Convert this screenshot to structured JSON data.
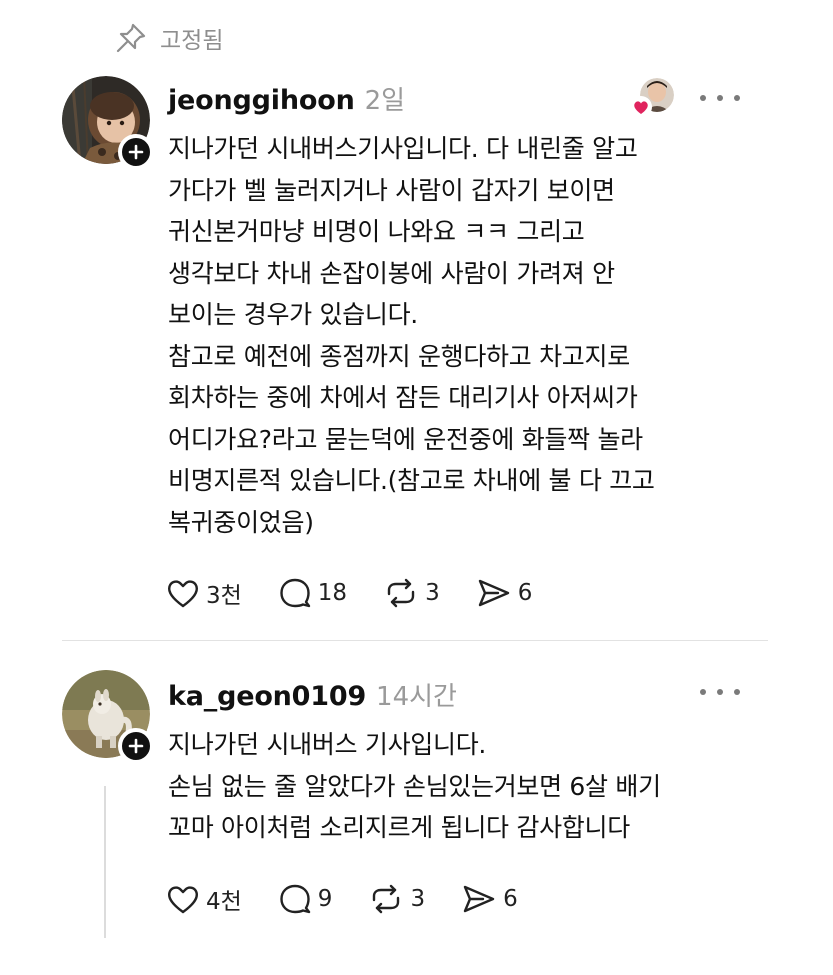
{
  "pinned": {
    "label": "고정됨",
    "icon": "pin-icon"
  },
  "posts": [
    {
      "username": "jeonggihoon",
      "time": "2일",
      "text": "지나가던 시내버스기사입니다. 다 내린줄 알고\n가다가 벨 눌러지거나 사람이 갑자기 보이면\n귀신본거마냥 비명이 나와요 ㅋㅋ 그리고\n생각보다 차내 손잡이봉에 사람이 가려져 안\n보이는 경우가 있습니다.\n참고로 예전에 종점까지 운행다하고 차고지로\n회차하는 중에 차에서 잠든 대리기사 아저씨가\n어디가요?라고 묻는덕에 운전중에 화들짝 놀라\n비명지른적 있습니다.(참고로 차내에 불 다 끄고\n복귀중이었음)",
      "likes": "3천",
      "replies": "18",
      "reposts": "3",
      "shares": "6",
      "liked_by_author_badge": true
    },
    {
      "username": "ka_geon0109",
      "time": "14시간",
      "text": "지나가던 시내버스 기사입니다.\n손님 없는 줄 알았다가 손님있는거보면 6살 배기\n꼬마 아이처럼 소리지르게 됩니다 감사합니다",
      "likes": "4천",
      "replies": "9",
      "reposts": "3",
      "shares": "6"
    }
  ],
  "colors": {
    "text": "#111111",
    "muted": "#9a9a9a",
    "heart": "#e0245e",
    "divider": "#e2e2e2"
  }
}
